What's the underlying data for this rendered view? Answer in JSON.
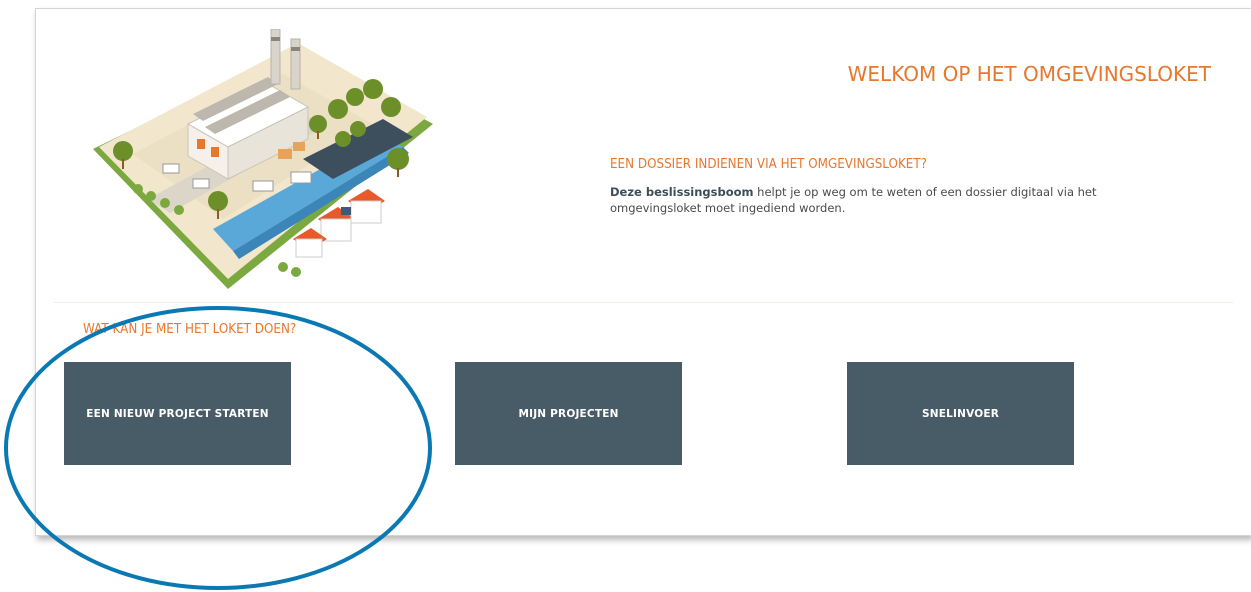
{
  "header": {
    "welcome_title": "WELKOM OP HET OMGEVINGSLOKET"
  },
  "info": {
    "title": "EEN DOSSIER INDIENEN VIA HET OMGEVINGSLOKET?",
    "link_text": "Deze beslissingsboom",
    "body_text": " helpt je op weg om te weten of een dossier digitaal via het omgevingsloket moet ingediend worden."
  },
  "actions": {
    "section_title": "WAT KAN JE MET HET LOKET DOEN?",
    "tiles": [
      {
        "label": "EEN NIEUW PROJECT STARTEN"
      },
      {
        "label": "MIJN PROJECTEN"
      },
      {
        "label": "SNELINVOER"
      }
    ]
  },
  "colors": {
    "accent_orange": "#e8772e",
    "tile_background": "#485c67",
    "highlight_ring": "#0a78b3"
  },
  "icons": {
    "illustration": "industrial-site-illustration"
  }
}
